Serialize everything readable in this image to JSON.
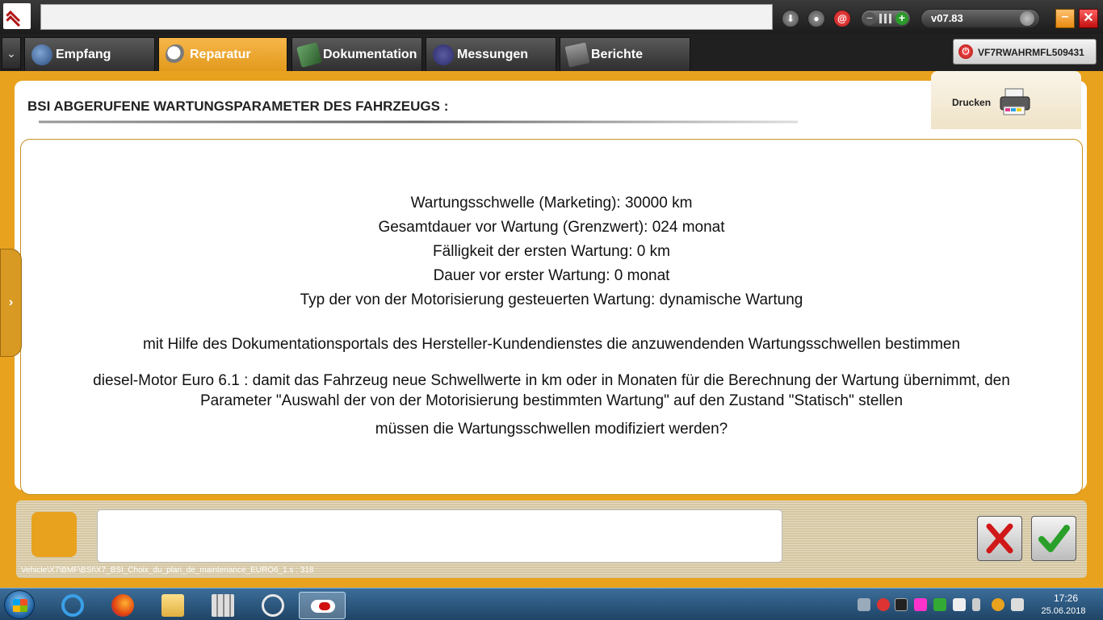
{
  "header": {
    "address_value": "",
    "version": "v07.83",
    "vin": "VF7RWAHRMFL509431"
  },
  "tabs": [
    {
      "label": "Empfang",
      "active": false
    },
    {
      "label": "Reparatur",
      "active": true
    },
    {
      "label": "Dokumentation",
      "active": false
    },
    {
      "label": "Messungen",
      "active": false
    },
    {
      "label": "Berichte",
      "active": false
    }
  ],
  "main": {
    "title": "BSI  ABGERUFENE WARTUNGSPARAMETER DES FAHRZEUGS :",
    "print_label": "Drucken",
    "lines": [
      "Wartungsschwelle (Marketing): 30000 km",
      "Gesamtdauer vor Wartung (Grenzwert): 024 monat",
      "Fälligkeit der ersten Wartung: 0 km",
      "Dauer vor erster Wartung: 0 monat",
      "Typ der von der Motorisierung gesteuerten Wartung: dynamische Wartung",
      "mit Hilfe des Dokumentationsportals des Hersteller-Kundendienstes die anzuwendenden Wartungsschwellen bestimmen",
      "diesel-Motor Euro 6.1 : damit das Fahrzeug neue Schwellwerte in km oder in Monaten für die Berechnung der Wartung übernimmt, den",
      "Parameter \"Auswahl der von der Motorisierung bestimmten Wartung\" auf den Zustand \"Statisch\" stellen",
      "müssen die Wartungsschwellen modifiziert werden?"
    ]
  },
  "footer": {
    "message_value": "",
    "path": "Vehicle\\X7\\BMF\\BSI\\X7_BSI_Choix_du_plan_de_maintenance_EURO6_1.s : 318"
  },
  "taskbar": {
    "time": "17:26",
    "date": "25.06.2018"
  },
  "colors": {
    "accent": "#e9a21e",
    "frame_border": "#c8901e"
  }
}
